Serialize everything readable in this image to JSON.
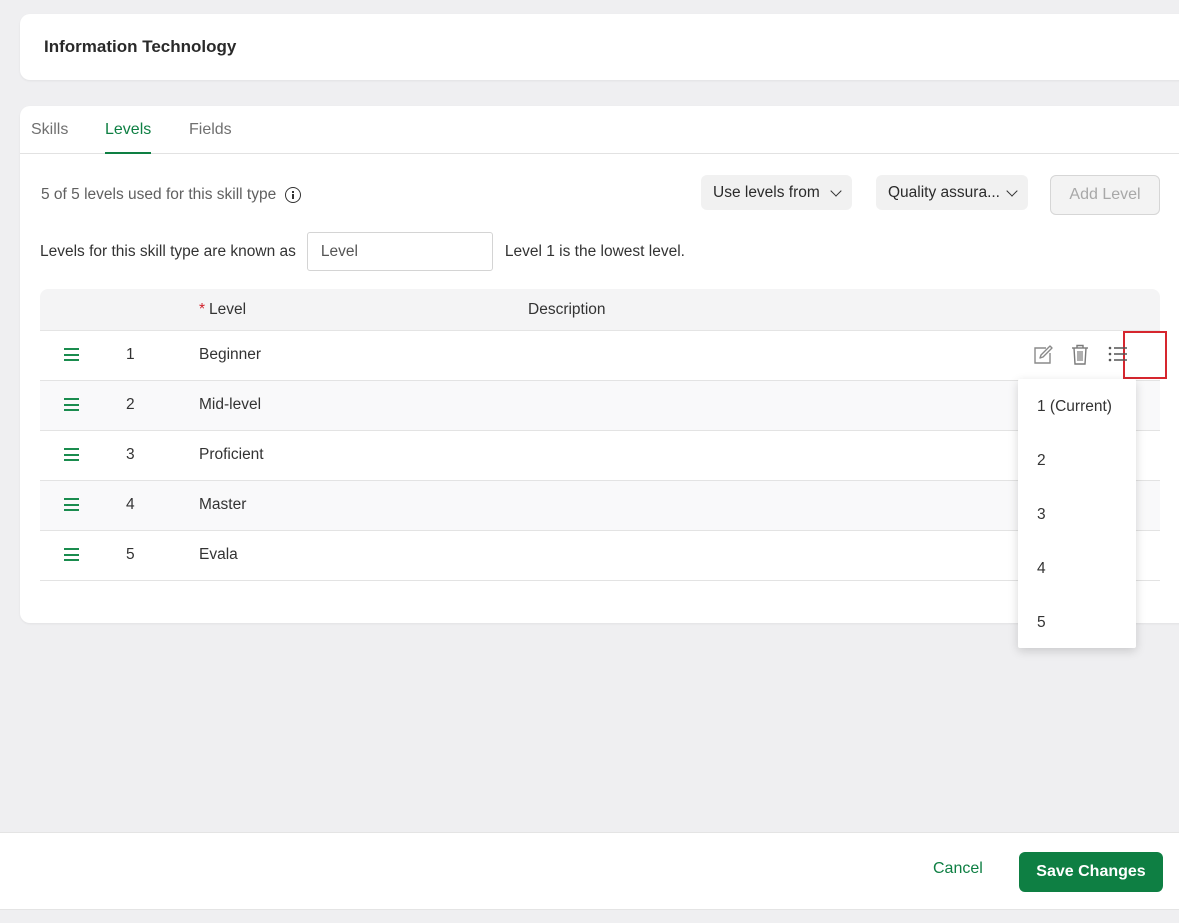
{
  "header": {
    "title": "Information Technology"
  },
  "tabs": [
    {
      "label": "Skills"
    },
    {
      "label": "Levels"
    },
    {
      "label": "Fields"
    }
  ],
  "active_tab": "Levels",
  "toolbar": {
    "usage_text": "5 of 5 levels used for this skill type",
    "use_levels_from_label": "Use levels from",
    "source_dropdown_value": "Quality assura...",
    "add_level_label": "Add Level"
  },
  "known_as": {
    "prefix": "Levels for this skill type are known as",
    "input_value": "Level",
    "suffix": "Level 1 is the lowest level."
  },
  "table": {
    "headers": {
      "required_marker": "*",
      "level": "Level",
      "description": "Description"
    },
    "rows": [
      {
        "number": "1",
        "level": "Beginner",
        "description": ""
      },
      {
        "number": "2",
        "level": "Mid-level",
        "description": ""
      },
      {
        "number": "3",
        "level": "Proficient",
        "description": ""
      },
      {
        "number": "4",
        "level": "Master",
        "description": ""
      },
      {
        "number": "5",
        "level": "Evala",
        "description": ""
      }
    ]
  },
  "reorder_menu": {
    "items": [
      "1 (Current)",
      "2",
      "3",
      "4",
      "5"
    ]
  },
  "footer": {
    "cancel_label": "Cancel",
    "save_label": "Save Changes"
  },
  "colors": {
    "accent": "#0e7f43",
    "highlight": "#d6262e",
    "background": "#efeff1"
  },
  "icons": [
    "info-icon",
    "chevron-down-icon",
    "drag-handle-icon",
    "edit-icon",
    "trash-icon",
    "list-reorder-icon"
  ]
}
